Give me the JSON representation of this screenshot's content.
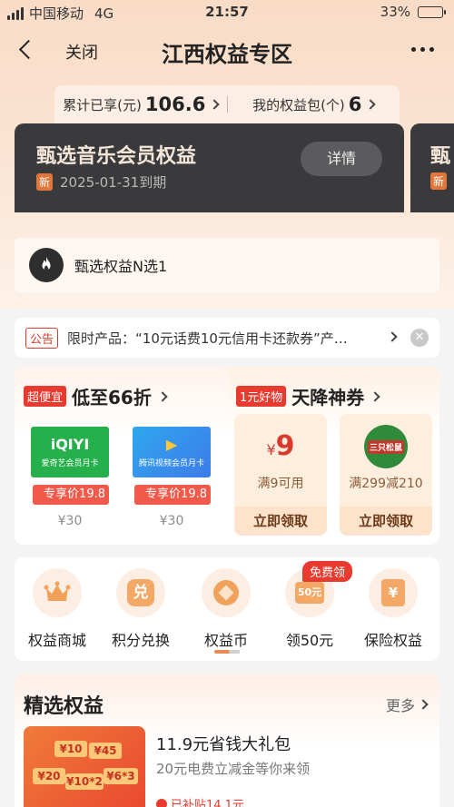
{
  "status_bar": {
    "carrier": "中国移动",
    "network": "4G",
    "time": "21:57",
    "battery": "33%",
    "battery_level": 0.33
  },
  "nav": {
    "close_label": "关闭",
    "title": "江西权益专区"
  },
  "stats": {
    "cumulative_label": "累计已享(元)",
    "cumulative_value": "106.6",
    "packages_label": "我的权益包(个)",
    "packages_value": "6"
  },
  "member_cards": [
    {
      "title": "甄选音乐会员权益",
      "badge": "新",
      "expire": "2025-01-31到期",
      "button": "详情"
    },
    {
      "title": "甄",
      "badge": "新"
    }
  ],
  "n_choose_one": {
    "label": "甄选权益N选1"
  },
  "notice": {
    "tag": "公告",
    "text": "限时产品：“10元话费10元信用卡还款券”产品..."
  },
  "deals": {
    "left": {
      "tag": "超便宜",
      "title": "低至66折",
      "items": [
        {
          "logo": "iQIYI",
          "sub": "爱奇艺会员月卡",
          "price_label": "专享价19.8",
          "orig_price": "¥30"
        },
        {
          "logo": "▶",
          "sub": "腾讯视频会员月卡",
          "price_label": "专享价19.8",
          "orig_price": "¥30"
        }
      ]
    },
    "right": {
      "tag": "1元好物",
      "title": "天降神券",
      "coupons": [
        {
          "currency": "¥",
          "amount": "9",
          "condition": "满9可用",
          "button": "立即领取"
        },
        {
          "logo": "三只松鼠",
          "condition": "满299减210",
          "button": "立即领取"
        }
      ]
    }
  },
  "services": {
    "badge": "免费领",
    "items": [
      {
        "label": "权益商城",
        "icon": "crown-icon"
      },
      {
        "label": "积分兑换",
        "icon": "exchange-icon",
        "glyph": "兑"
      },
      {
        "label": "权益币",
        "icon": "coin-icon"
      },
      {
        "label": "领50元",
        "icon": "coupon-box-icon",
        "glyph": "50元"
      },
      {
        "label": "保险权益",
        "icon": "shield-icon",
        "glyph": "¥"
      }
    ]
  },
  "featured": {
    "title": "精选权益",
    "more": "更多",
    "item": {
      "name": "11.9元省钱大礼包",
      "desc": "20元电费立减金等你来领",
      "subsidy": "已补贴14.1元",
      "tiles": [
        "¥10",
        "¥45",
        "¥20",
        "¥10*2",
        "¥6*3"
      ]
    }
  },
  "colors": {
    "accent": "#e93a2f",
    "hero_bg": "#f9dcc6",
    "card_dark": "#3a3a3d",
    "coupon_bg": "#fdeede"
  }
}
